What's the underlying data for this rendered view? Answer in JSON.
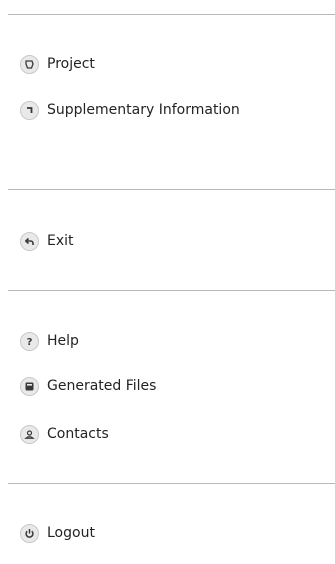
{
  "menu": {
    "group1": [
      {
        "label": "Project",
        "icon": "project-icon"
      },
      {
        "label": "Supplementary Information",
        "icon": "supplementary-info-icon"
      }
    ],
    "group2": [
      {
        "label": "Exit",
        "icon": "exit-icon"
      }
    ],
    "group3": [
      {
        "label": "Help",
        "icon": "help-icon"
      },
      {
        "label": "Generated Files",
        "icon": "generated-files-icon"
      },
      {
        "label": "Contacts",
        "icon": "contacts-icon"
      }
    ],
    "group4": [
      {
        "label": "Logout",
        "icon": "logout-icon"
      }
    ]
  },
  "colors": {
    "text": "#232323",
    "icon_bg": "#e9e9e9",
    "icon_stroke": "#3a3a3a",
    "divider": "#b9b9b9"
  }
}
